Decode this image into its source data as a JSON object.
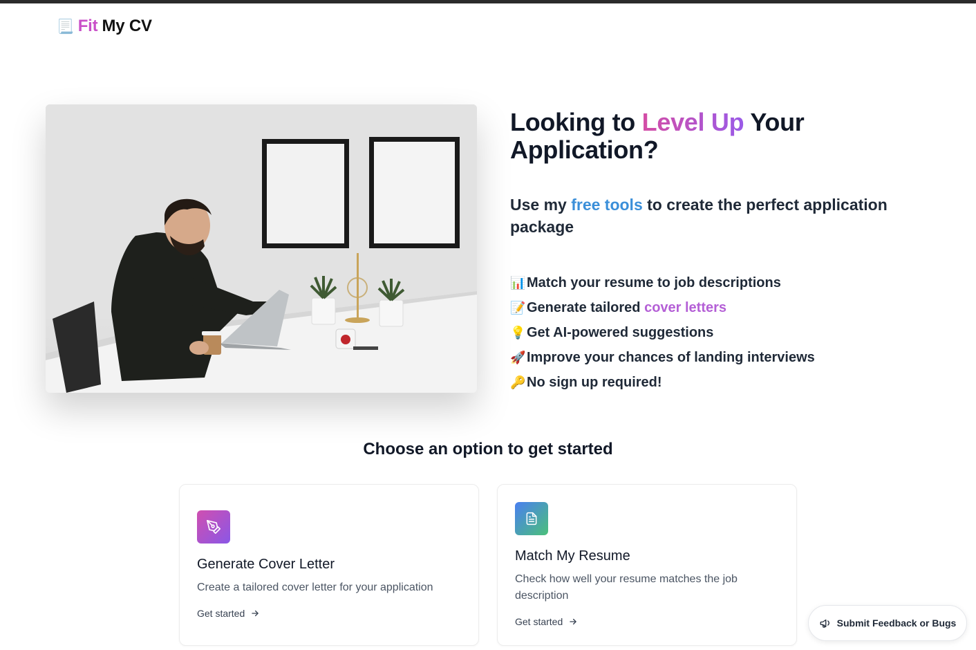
{
  "header": {
    "logo_icon": "scroll-icon",
    "logo_emoji": "📃",
    "logo_word1": "Fit",
    "logo_word2": "My CV",
    "brand_color": "#c94fc8"
  },
  "hero": {
    "image_alt": "Man working on a laptop at a desk",
    "headline_part1": "Looking to ",
    "headline_highlight": "Level Up",
    "headline_part2": " Your Application?",
    "subhead_part1": "Use my ",
    "subhead_highlight": "free tools",
    "subhead_part2": " to create the perfect application package",
    "features": [
      {
        "icon": "chart-icon",
        "emoji": "📊",
        "text": "Match your resume to job descriptions",
        "highlight": ""
      },
      {
        "icon": "memo-icon",
        "emoji": "📝",
        "text": "Generate tailored ",
        "highlight": "cover letters"
      },
      {
        "icon": "lightbulb-icon",
        "emoji": "💡",
        "text": "Get AI-powered suggestions",
        "highlight": ""
      },
      {
        "icon": "rocket-icon",
        "emoji": "🚀",
        "text": "Improve your chances of landing interviews",
        "highlight": ""
      },
      {
        "icon": "key-icon",
        "emoji": "🔑",
        "text": "No sign up required!",
        "highlight": ""
      }
    ]
  },
  "options": {
    "heading": "Choose an option to get started",
    "cards": [
      {
        "icon": "pen-nib-icon",
        "title": "Generate Cover Letter",
        "description": "Create a tailored cover letter for your application",
        "cta": "Get started"
      },
      {
        "icon": "document-icon",
        "title": "Match My Resume",
        "description": "Check how well your resume matches the job description",
        "cta": "Get started"
      }
    ]
  },
  "feedback": {
    "icon": "megaphone-icon",
    "label": "Submit Feedback or Bugs"
  },
  "colors": {
    "accent_pink": "#d44da5",
    "accent_purple": "#9a5ae8",
    "accent_blue": "#3b8fd9",
    "text_dark": "#111827"
  }
}
